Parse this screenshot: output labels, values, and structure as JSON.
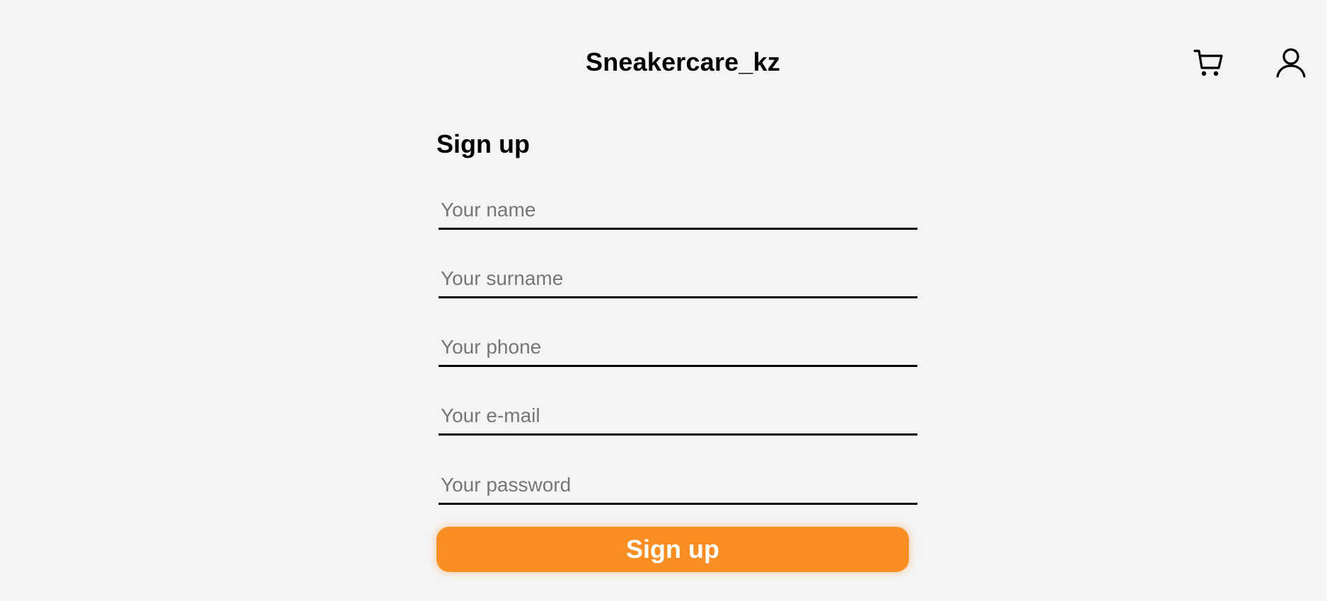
{
  "header": {
    "brand": "Sneakercare_kz",
    "cart_icon": "cart-icon",
    "user_icon": "user-icon"
  },
  "signup": {
    "title": "Sign up",
    "fields": [
      {
        "name": "name",
        "placeholder": "Your name",
        "value": ""
      },
      {
        "name": "surname",
        "placeholder": "Your surname",
        "value": ""
      },
      {
        "name": "phone",
        "placeholder": "Your phone",
        "value": ""
      },
      {
        "name": "email",
        "placeholder": "Your e-mail",
        "value": ""
      },
      {
        "name": "password",
        "placeholder": "Your password",
        "value": ""
      }
    ],
    "submit_label": "Sign up"
  },
  "colors": {
    "background": "#f4f4f4",
    "accent": "#f98e24",
    "text": "#000000",
    "placeholder": "#767676"
  }
}
